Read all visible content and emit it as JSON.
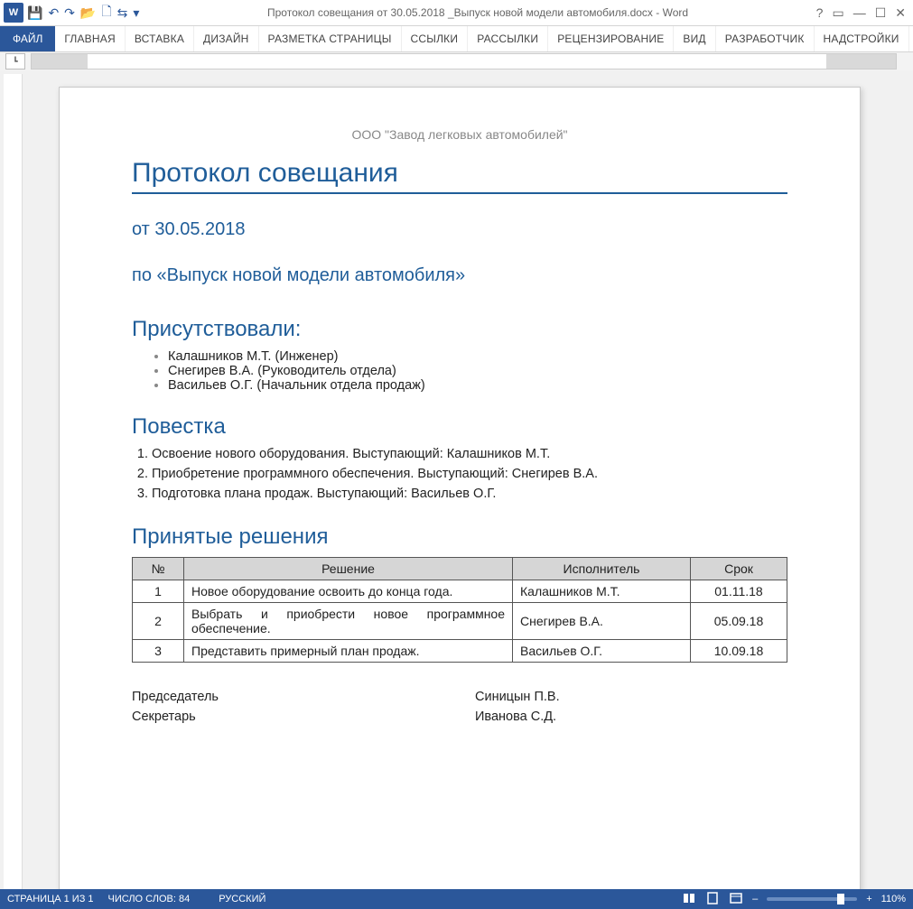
{
  "app": {
    "logo_text": "W",
    "title": "Протокол совещания от 30.05.2018 _Выпуск новой модели автомобиля.docx - Word"
  },
  "qat": {
    "save": "💾",
    "undo": "↶",
    "redo": "↷",
    "open": "📂",
    "new": "🗋",
    "arrows": "⇆",
    "more": "▾"
  },
  "win": {
    "help": "?",
    "ribbon_opts": "▭",
    "min": "—",
    "max": "☐",
    "close": "✕"
  },
  "ribbon": {
    "file": "ФАЙЛ",
    "tabs": [
      "ГЛАВНАЯ",
      "ВСТАВКА",
      "ДИЗАЙН",
      "РАЗМЕТКА СТРАНИЦЫ",
      "ССЫЛКИ",
      "РАССЫЛКИ",
      "РЕЦЕНЗИРОВАНИЕ",
      "ВИД",
      "РАЗРАБОТЧИК",
      "НАДСТРОЙКИ"
    ]
  },
  "ruler": {
    "tab_well": "┗"
  },
  "doc": {
    "org": "ООО \"Завод легковых автомобилей\"",
    "title": "Протокол совещания",
    "date_line": "от 30.05.2018",
    "topic_line": "по «Выпуск новой модели автомобиля»",
    "attendees_h": "Присутствовали:",
    "attendees": [
      "Калашников М.Т. (Инженер)",
      "Снегирев В.А. (Руководитель отдела)",
      "Васильев О.Г. (Начальник отдела продаж)"
    ],
    "agenda_h": "Повестка",
    "agenda": [
      "Освоение нового оборудования. Выступающий: Калашников М.Т.",
      "Приобретение программного обеспечения. Выступающий: Снегирев В.А.",
      "Подготовка плана продаж. Выступающий: Васильев О.Г."
    ],
    "decisions_h": "Принятые решения",
    "dec_headers": {
      "n": "№",
      "r": "Решение",
      "e": "Исполнитель",
      "d": "Срок"
    },
    "decisions": [
      {
        "n": "1",
        "r": "Новое оборудование освоить до конца года.",
        "e": "Калашников М.Т.",
        "d": "01.11.18"
      },
      {
        "n": "2",
        "r": "Выбрать и приобрести новое программное обеспечение.",
        "e": "Снегирев В.А.",
        "d": "05.09.18"
      },
      {
        "n": "3",
        "r": "Представить примерный план продаж.",
        "e": "Васильев О.Г.",
        "d": "10.09.18"
      }
    ],
    "sign": [
      {
        "role": "Председатель",
        "name": "Синицын П.В."
      },
      {
        "role": "Секретарь",
        "name": "Иванова С.Д."
      }
    ]
  },
  "status": {
    "page": "СТРАНИЦА 1 ИЗ 1",
    "words": "ЧИСЛО СЛОВ: 84",
    "lang": "РУССКИЙ",
    "zoom": "110%"
  }
}
